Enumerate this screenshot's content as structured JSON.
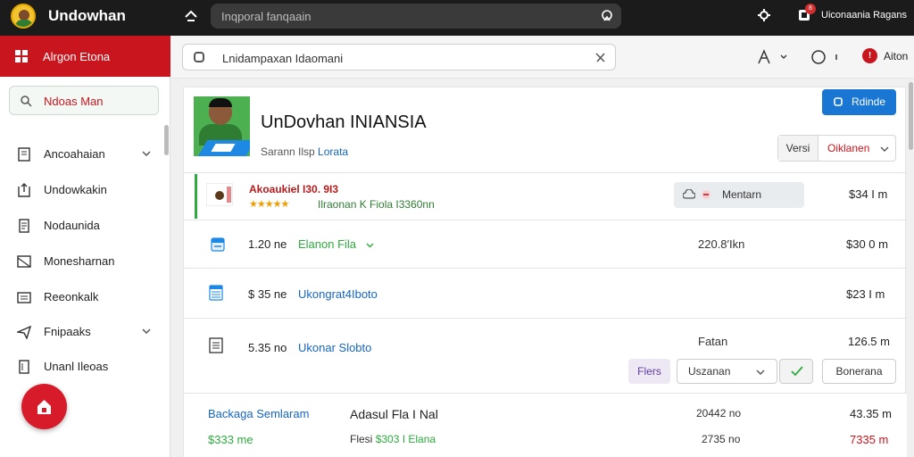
{
  "colors": {
    "topbar": "#1b1b1b",
    "accent_red": "#c9161e",
    "accent_blue": "#1976d2",
    "accent_green": "#2eaa3e",
    "star": "#f29d00"
  },
  "topbar": {
    "app_title": "Undowhan",
    "search_placeholder": "Inqporal fanqaain",
    "user_name": "Uiconaania Ragans",
    "notification_count": "8",
    "icons": [
      "home-icon",
      "search-icon",
      "settings-icon",
      "notification-icon"
    ]
  },
  "sidebar": {
    "header_label": "Alrgon Etona",
    "search_label": "Ndoas Man",
    "items": [
      {
        "label": "Ancoahaian",
        "icon": "document-icon",
        "expandable": true
      },
      {
        "label": "Undowkakin",
        "icon": "export-icon",
        "expandable": false
      },
      {
        "label": "Nodaunida",
        "icon": "file-icon",
        "expandable": false
      },
      {
        "label": "Monesharnan",
        "icon": "image-icon",
        "expandable": false
      },
      {
        "label": "Reeonkalk",
        "icon": "folder-icon",
        "expandable": false
      },
      {
        "label": "Fnipaaks",
        "icon": "send-icon",
        "expandable": true
      },
      {
        "label": "Unanl Ileoas",
        "icon": "list-icon",
        "expandable": false
      }
    ]
  },
  "toolbar": {
    "doc_search_value": "Lnidampaxan Idaomani",
    "alert_label": "Aiton",
    "alert_badge": "!"
  },
  "profile": {
    "title": "UnDovhan INIANSIA",
    "subtitle_prefix": "Sarann Ilsp",
    "subtitle_link": "Lorata",
    "edit_label": "Rdinde",
    "version_label": "Versi",
    "version_value": "Oiklanen"
  },
  "highlight": {
    "title": "Akoaukiel I30. 9I3",
    "stars": "★★★★★",
    "subtitle": "Ilraonan K Fiola I3360nn",
    "mention_label": "Mentarn",
    "price": "$34 I m"
  },
  "rows": [
    {
      "qty": "1.20 ne",
      "name": "Elanon Fila",
      "has_chevron": true,
      "mid": "220.8′Ikn",
      "price": "$30 0 m",
      "name_color": "#2eaa3e",
      "icon": "calendar-icon"
    },
    {
      "qty": "$ 35 ne",
      "name": "Ukongrat4Iboto",
      "has_chevron": false,
      "mid": "",
      "price": "$23 I m",
      "name_color": "#1565c0",
      "icon": "spreadsheet-icon"
    },
    {
      "qty": "5.35 no",
      "name": "Ukonar Slobto",
      "has_chevron": false,
      "mid": "Fatan",
      "price": "126.5 m",
      "name_color": "#1565c0",
      "icon": "document-icon"
    }
  ],
  "actions": {
    "files_label": "Flers",
    "select_label": "Uszanan",
    "download_label": "Bonerana"
  },
  "footer": {
    "name": "Backaga Semlaram",
    "total": "$333 me",
    "description": "Adasul Fla I Nal",
    "fees_label": "Flesi",
    "fees_value": "$303 I Elana",
    "metric_1": "20442 no",
    "metric_2": "2735 no",
    "price_1": "43.35 m",
    "price_2": "7335 m"
  }
}
